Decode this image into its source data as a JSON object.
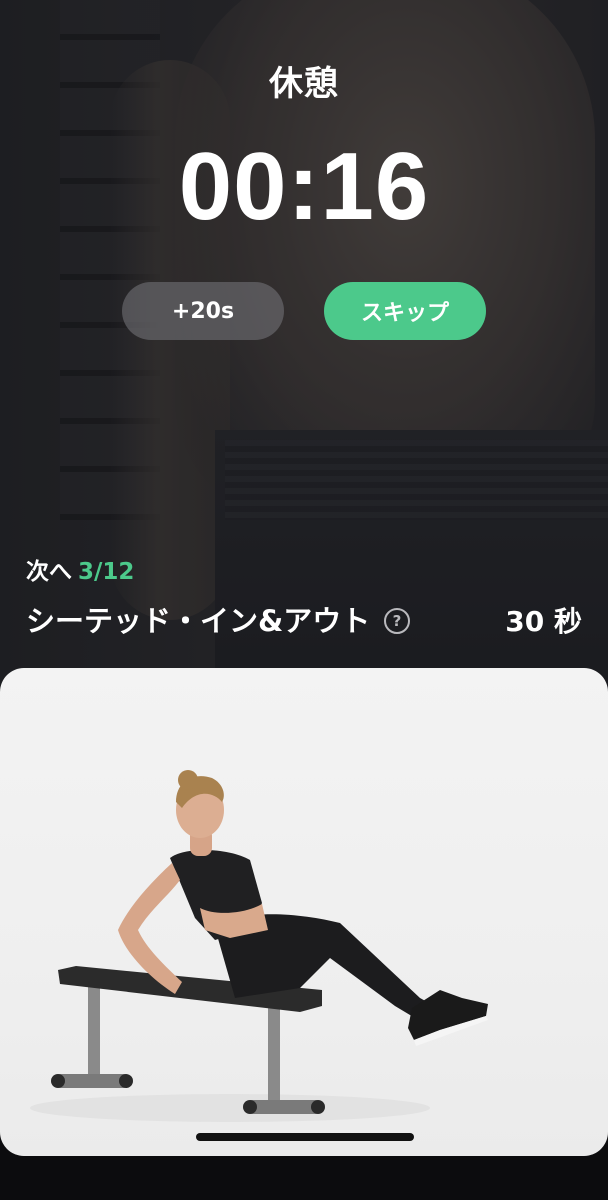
{
  "rest": {
    "title": "休憩",
    "timer": "00:16",
    "add_time_label": "+20s",
    "skip_label": "スキップ"
  },
  "next": {
    "label": "次へ",
    "progress": "3/12",
    "exercise_name": "シーテッド・イン&アウト",
    "duration": "30 秒",
    "help_icon_glyph": "?"
  },
  "colors": {
    "accent": "#4cc98b",
    "background": "#0c0c0e",
    "card": "#f0f0f0"
  },
  "icons": {
    "help": "question-circle-icon"
  }
}
